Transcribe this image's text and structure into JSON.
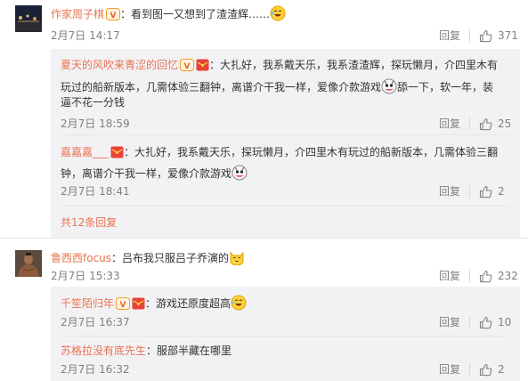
{
  "comments": [
    {
      "user": "作家周子棋",
      "text": "：看到图一又想到了渣渣辉……",
      "time": "2月7日 14:17",
      "reply_label": "回复",
      "likes": "371",
      "replies": [
        {
          "user": "夏天的风吹来青涩的回忆",
          "line1": "：大扎好，我系戴天乐，我系渣渣辉，探玩懒月，介四里木有",
          "line2": "玩过的船新版本，几需体验三翻钟，离谱介干我一样，爱像介款游戏",
          "line2b": "舔一下，软一年，装",
          "line3": "逼不花一分钱",
          "time": "2月7日 18:59",
          "reply_label": "回复",
          "likes": "25"
        },
        {
          "user": "嘉嘉嘉___",
          "line1": "：大扎好，我系戴天乐，探玩懒月，介四里木有玩过的船新版本，几需体验三翻",
          "line2": "钟，离谱介干我一样，爱像介款游戏",
          "time": "2月7日 18:41",
          "reply_label": "回复",
          "likes": "2"
        }
      ],
      "more_replies": "共12条回复"
    },
    {
      "user": "鲁西西focus",
      "text": "：吕布我只服吕子乔演的",
      "time": "2月7日 15:33",
      "reply_label": "回复",
      "likes": "232",
      "replies": [
        {
          "user": "千笙陌归年",
          "line1": "：游戏还原度超高",
          "time": "2月7日 16:37",
          "reply_label": "回复",
          "likes": "10"
        },
        {
          "user": "苏格拉没有底先生",
          "line1": "：服部半藏在哪里",
          "time": "2月7日 16:32",
          "reply_label": "回复",
          "likes": "2"
        }
      ]
    }
  ],
  "icons": {
    "thumb": "thumbs-up-icon",
    "badge_vip": "vip-badge-icon",
    "badge_red": "red-envelope-badge-icon",
    "emoji_laugh": "laughing-emoji-icon",
    "emoji_cat": "cat-emoji-icon",
    "emoji_doge": "doge-emoji-icon"
  },
  "colors": {
    "username": "#eb7350",
    "meta": "#808080",
    "reply_bg": "#f2f2f5"
  }
}
